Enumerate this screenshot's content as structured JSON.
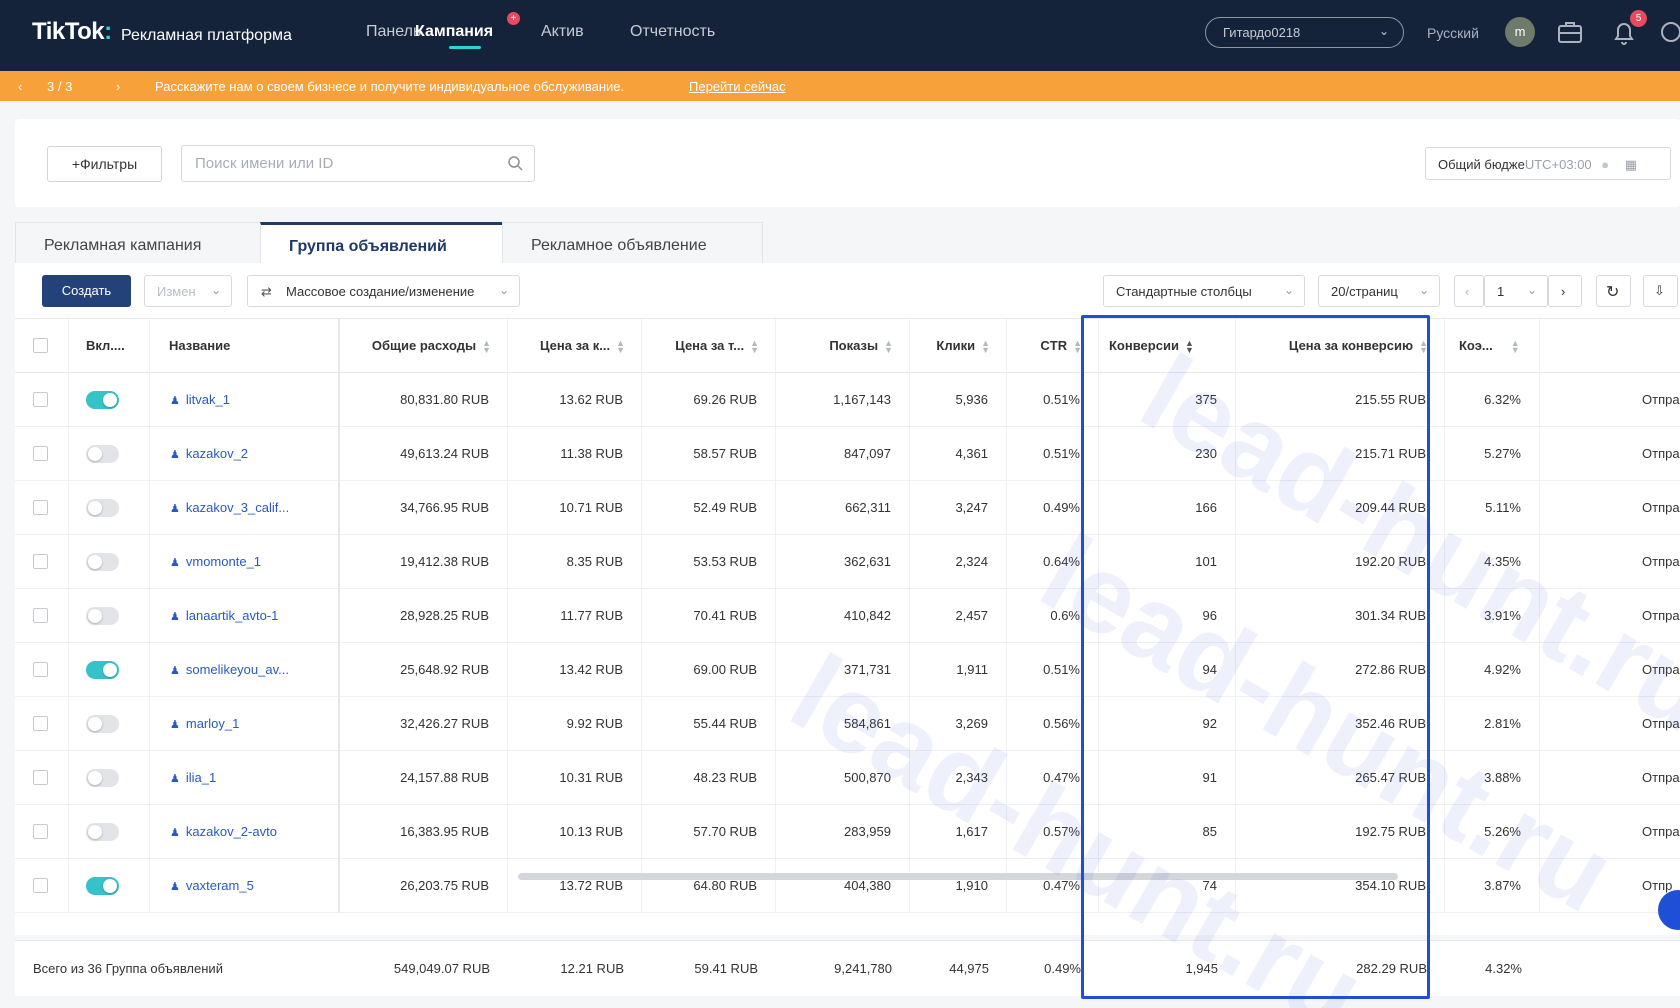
{
  "nav": {
    "logo": "TikTok",
    "logo_sub": "Рекламная платформа",
    "items": [
      "Панель",
      "Кампания",
      "Актив",
      "Отчетность"
    ],
    "account": "Гитардо0218",
    "language": "Русский",
    "avatar_letter": "m",
    "notifications_count": "5",
    "new_badge": "+"
  },
  "banner": {
    "pager": "3 / 3",
    "text": "Расскажите нам о своем бизнесе и получите индивидуальное обслуживание.",
    "link": "Перейти сейчас"
  },
  "filters": {
    "filters_button": "+Фильтры",
    "search_placeholder": "Поиск имени или ID",
    "budget_label": "Общий бюдже",
    "timezone": "UTC+03:00"
  },
  "tabs": [
    "Рекламная кампания",
    "Группа объявлений",
    "Рекламное объявление"
  ],
  "toolbar": {
    "create": "Создать",
    "edit": "Измен",
    "bulk": "Массовое создание/изменение",
    "columns": "Стандартные столбцы",
    "per_page": "20/страниц",
    "page": "1"
  },
  "table": {
    "headers": {
      "on": "Вкл....",
      "name": "Название",
      "spend": "Общие расходы",
      "cpc": "Цена за к...",
      "cpm": "Цена за т...",
      "impressions": "Показы",
      "clicks": "Клики",
      "ctr": "CTR",
      "conversions": "Конверсии",
      "cpa": "Цена за конверсию",
      "cvr": "Коэ...",
      "extra": ""
    },
    "rows": [
      {
        "on": true,
        "name": "litvak_1",
        "spend": "80,831.80 RUB",
        "cpc": "13.62 RUB",
        "cpm": "69.26 RUB",
        "impressions": "1,167,143",
        "clicks": "5,936",
        "ctr": "0.51%",
        "conversions": "375",
        "cpa": "215.55 RUB",
        "cvr": "6.32%",
        "extra": "Отправ"
      },
      {
        "on": false,
        "name": "kazakov_2",
        "spend": "49,613.24 RUB",
        "cpc": "11.38 RUB",
        "cpm": "58.57 RUB",
        "impressions": "847,097",
        "clicks": "4,361",
        "ctr": "0.51%",
        "conversions": "230",
        "cpa": "215.71 RUB",
        "cvr": "5.27%",
        "extra": "Отправ"
      },
      {
        "on": false,
        "name": "kazakov_3_calif...",
        "spend": "34,766.95 RUB",
        "cpc": "10.71 RUB",
        "cpm": "52.49 RUB",
        "impressions": "662,311",
        "clicks": "3,247",
        "ctr": "0.49%",
        "conversions": "166",
        "cpa": "209.44 RUB",
        "cvr": "5.11%",
        "extra": "Отправ"
      },
      {
        "on": false,
        "name": "vmomonte_1",
        "spend": "19,412.38 RUB",
        "cpc": "8.35 RUB",
        "cpm": "53.53 RUB",
        "impressions": "362,631",
        "clicks": "2,324",
        "ctr": "0.64%",
        "conversions": "101",
        "cpa": "192.20 RUB",
        "cvr": "4.35%",
        "extra": "Отправ"
      },
      {
        "on": false,
        "name": "lanaartik_avto-1",
        "spend": "28,928.25 RUB",
        "cpc": "11.77 RUB",
        "cpm": "70.41 RUB",
        "impressions": "410,842",
        "clicks": "2,457",
        "ctr": "0.6%",
        "conversions": "96",
        "cpa": "301.34 RUB",
        "cvr": "3.91%",
        "extra": "Отправ"
      },
      {
        "on": true,
        "name": "somelikeyou_av...",
        "spend": "25,648.92 RUB",
        "cpc": "13.42 RUB",
        "cpm": "69.00 RUB",
        "impressions": "371,731",
        "clicks": "1,911",
        "ctr": "0.51%",
        "conversions": "94",
        "cpa": "272.86 RUB",
        "cvr": "4.92%",
        "extra": "Отправ"
      },
      {
        "on": false,
        "name": "marloy_1",
        "spend": "32,426.27 RUB",
        "cpc": "9.92 RUB",
        "cpm": "55.44 RUB",
        "impressions": "584,861",
        "clicks": "3,269",
        "ctr": "0.56%",
        "conversions": "92",
        "cpa": "352.46 RUB",
        "cvr": "2.81%",
        "extra": "Отправ"
      },
      {
        "on": false,
        "name": "ilia_1",
        "spend": "24,157.88 RUB",
        "cpc": "10.31 RUB",
        "cpm": "48.23 RUB",
        "impressions": "500,870",
        "clicks": "2,343",
        "ctr": "0.47%",
        "conversions": "91",
        "cpa": "265.47 RUB",
        "cvr": "3.88%",
        "extra": "Отправ"
      },
      {
        "on": false,
        "name": "kazakov_2-avto",
        "spend": "16,383.95 RUB",
        "cpc": "10.13 RUB",
        "cpm": "57.70 RUB",
        "impressions": "283,959",
        "clicks": "1,617",
        "ctr": "0.57%",
        "conversions": "85",
        "cpa": "192.75 RUB",
        "cvr": "5.26%",
        "extra": "Отправ"
      },
      {
        "on": true,
        "name": "vaxteram_5",
        "spend": "26,203.75 RUB",
        "cpc": "13.72 RUB",
        "cpm": "64.80 RUB",
        "impressions": "404,380",
        "clicks": "1,910",
        "ctr": "0.47%",
        "conversions": "74",
        "cpa": "354.10 RUB",
        "cvr": "3.87%",
        "extra": "Отпр"
      }
    ],
    "totals": {
      "label": "Всего из 36 Группа объявлений",
      "spend": "549,049.07 RUB",
      "cpc": "12.21 RUB",
      "cpm": "59.41 RUB",
      "impressions": "9,241,780",
      "clicks": "44,975",
      "ctr": "0.49%",
      "conversions": "1,945",
      "cpa": "282.29 RUB",
      "cvr": "4.32%"
    }
  },
  "watermark": "lead-hunt.ru",
  "colors": {
    "nav_bg": "#14223a",
    "banner": "#f6a13a",
    "primary": "#23427a",
    "toggle_on": "#35c3c9",
    "link": "#2a58c4",
    "highlight": "#1f4fd6"
  }
}
